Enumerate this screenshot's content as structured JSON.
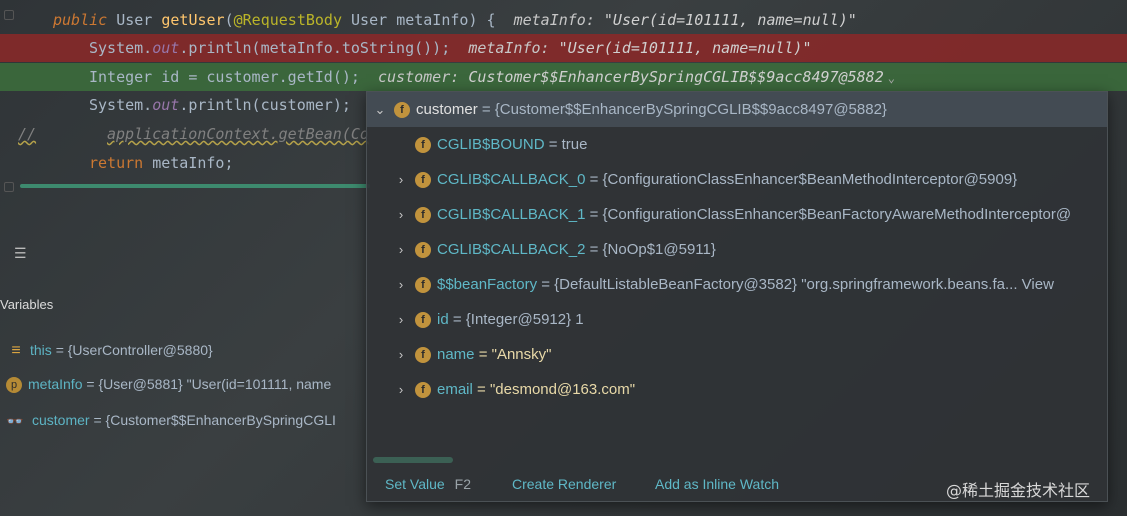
{
  "editor": {
    "line1": {
      "public": "public",
      "user_type": "User",
      "method": "getUser",
      "open_paren": "(",
      "annotation": "@RequestBody",
      "param_type": "User",
      "param_name": "metaInfo",
      "close": ") {",
      "hint_name": "metaInfo:",
      "hint_value": "\"User(id=101111, name=null)\""
    },
    "line2": {
      "system": "System.",
      "out": "out",
      "rest": ".println(metaInfo.toString());",
      "hint_name": "metaInfo:",
      "hint_value": "\"User(id=101111, name=null)\""
    },
    "line3": {
      "type": "Integer",
      "rest": "id = customer.getId();",
      "hint_name": "customer:",
      "hint_value": "Customer$$EnhancerBySpringCGLIB$$9acc8497@5882"
    },
    "line4": {
      "system": "System.",
      "out": "out",
      "rest": ".println(customer);"
    },
    "line5": {
      "slashes": "//",
      "comment": "applicationContext.getBean(Co"
    },
    "line6": {
      "return": "return",
      "rest": "metaInfo;"
    }
  },
  "variables_panel": {
    "title": "Variables",
    "rows": [
      {
        "name": "this",
        "value": "= {UserController@5880}"
      },
      {
        "name": "metaInfo",
        "value": "= {User@5881} \"User(id=101111, name"
      },
      {
        "name": "customer",
        "value": "= {Customer$$EnhancerBySpringCGLI"
      }
    ]
  },
  "popup": {
    "root": {
      "name": "customer",
      "value": "= {Customer$$EnhancerBySpringCGLIB$$9acc8497@5882}"
    },
    "children": [
      {
        "name": "CGLIB$BOUND",
        "value": "= true",
        "expandable": false
      },
      {
        "name": "CGLIB$CALLBACK_0",
        "value": "= {ConfigurationClassEnhancer$BeanMethodInterceptor@5909}",
        "expandable": true
      },
      {
        "name": "CGLIB$CALLBACK_1",
        "value": "= {ConfigurationClassEnhancer$BeanFactoryAwareMethodInterceptor@",
        "expandable": true
      },
      {
        "name": "CGLIB$CALLBACK_2",
        "value": "= {NoOp$1@5911}",
        "expandable": true
      },
      {
        "name": "$$beanFactory",
        "value": "= {DefaultListableBeanFactory@3582} \"org.springframework.beans.fa...",
        "link": "View",
        "expandable": true
      },
      {
        "name": "id",
        "value": "= {Integer@5912} 1",
        "expandable": true
      },
      {
        "name": "name",
        "value": "= \"Annsky\"",
        "expandable": true
      },
      {
        "name": "email",
        "value": "= \"desmond@163.com\"",
        "expandable": true
      }
    ],
    "actions": {
      "set_value": "Set Value",
      "set_value_shortcut": "F2",
      "create_renderer": "Create Renderer",
      "add_inline_watch": "Add as Inline Watch"
    }
  },
  "watermark": "@稀土掘金技术社区",
  "icons": {
    "field_letter": "f",
    "param_letter": "p"
  }
}
